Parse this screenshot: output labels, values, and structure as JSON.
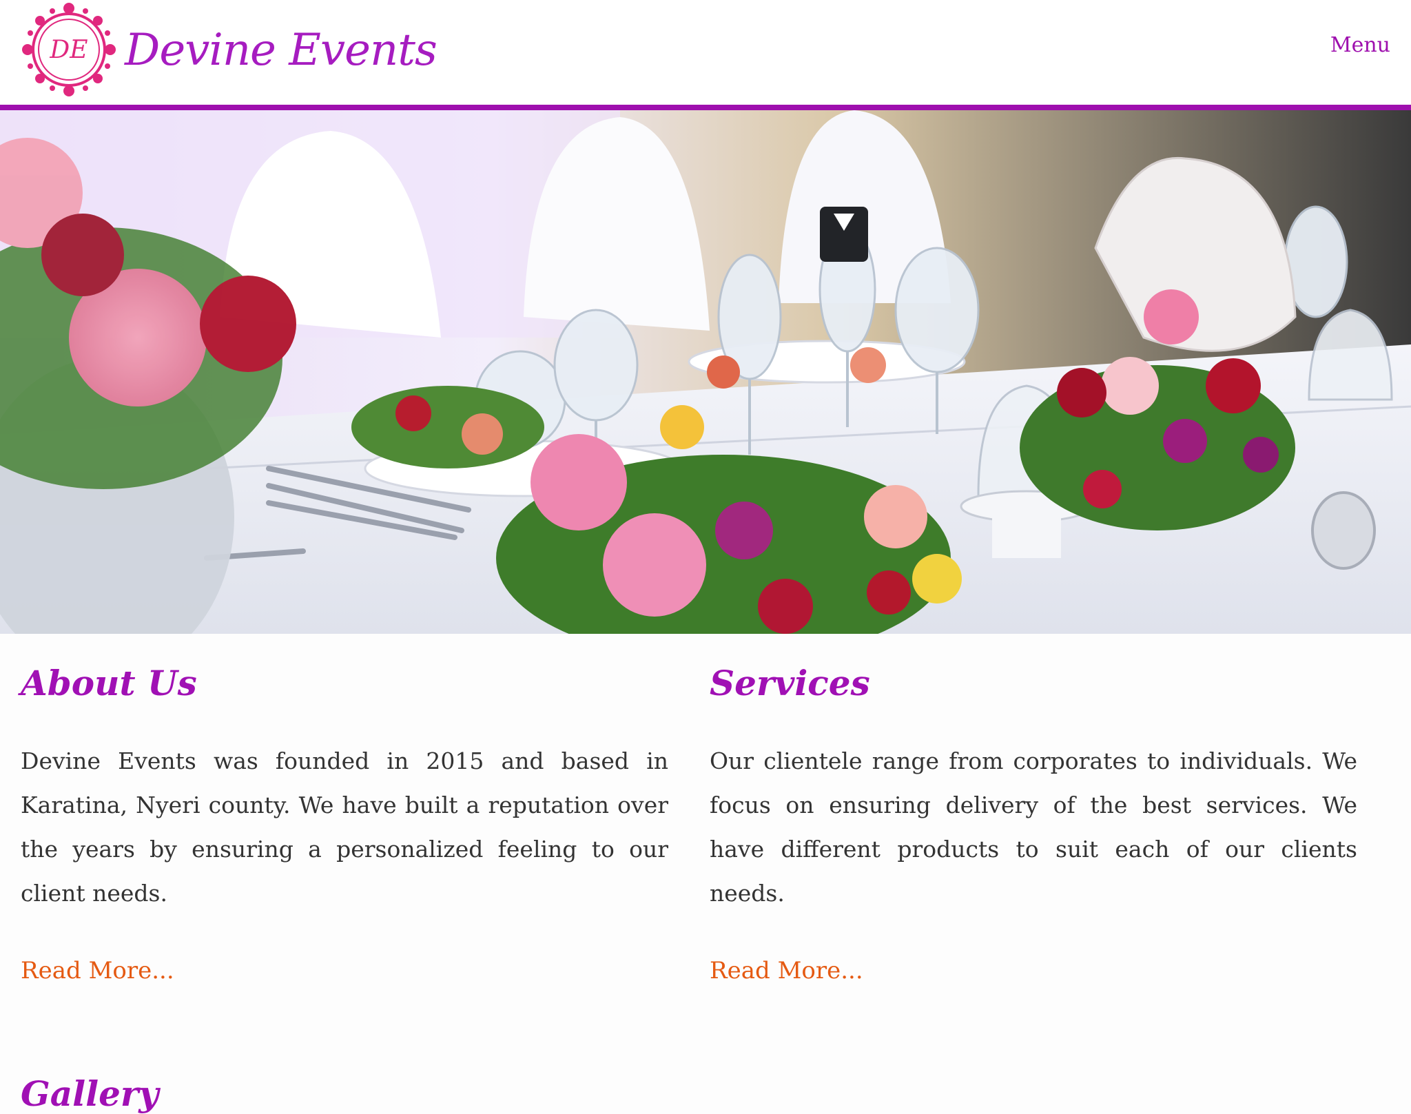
{
  "header": {
    "logo_monogram": "DE",
    "brand_name": "Devine Events",
    "menu_label": "Menu"
  },
  "hero": {
    "image_alt": "Decorated banquet table with floral centerpieces"
  },
  "about": {
    "title": "About Us",
    "body": "Devine Events was founded in 2015 and based in Karatina, Nyeri county. We have built a reputation over the years by ensuring a personalized feeling to our client needs.",
    "link": "Read More..."
  },
  "services": {
    "title": "Services",
    "body": "Our clientele range from corporates to individuals. We focus on ensuring delivery of the best services. We have different products to suit each of our clients needs.",
    "link": "Read More..."
  },
  "gallery": {
    "title": "Gallery"
  },
  "colors": {
    "brand_purple": "#a010b4",
    "header_rule": "#9e0fae",
    "logo_pink": "#e0287e",
    "link_orange": "#e55a12",
    "body_text": "#333333"
  }
}
